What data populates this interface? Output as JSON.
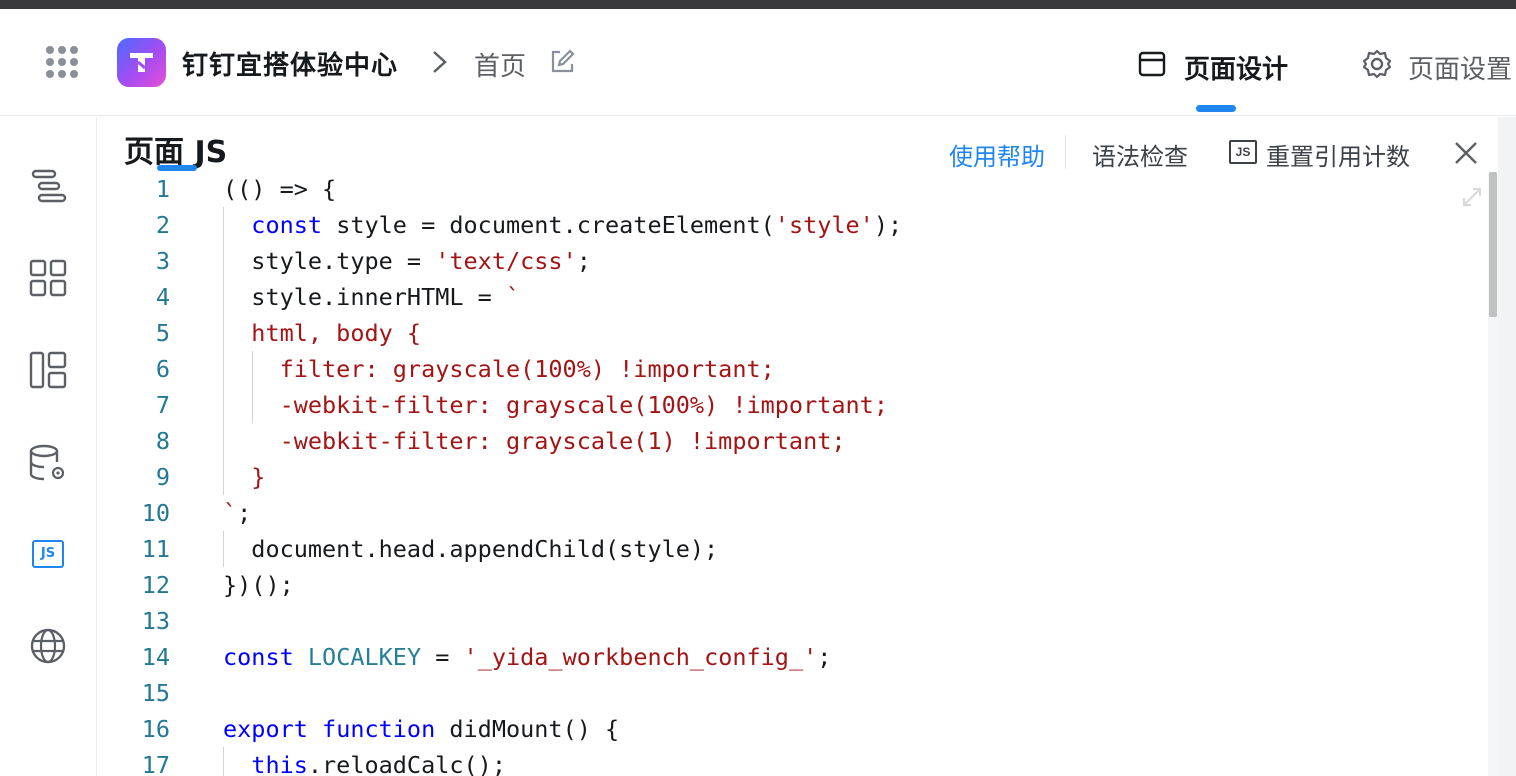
{
  "header": {
    "app_title": "钉钉宜搭体验中心",
    "breadcrumb_page": "首页",
    "tabs": [
      {
        "label": "页面设计",
        "icon": "browser-window-icon",
        "active": true
      },
      {
        "label": "页面设置",
        "icon": "gear-icon",
        "active": false
      }
    ]
  },
  "sidebar": {
    "items": [
      {
        "name": "outline-tree-icon"
      },
      {
        "name": "components-grid-icon"
      },
      {
        "name": "layout-template-icon"
      },
      {
        "name": "data-source-icon"
      },
      {
        "name": "js-icon",
        "active": true,
        "label": "JS"
      },
      {
        "name": "globe-icon"
      }
    ]
  },
  "panel": {
    "title": "页面 JS",
    "actions": {
      "help": "使用帮助",
      "lint": "语法检查",
      "js_badge": "JS",
      "reset": "重置引用计数"
    }
  },
  "code": {
    "lines": [
      {
        "n": "1",
        "t": "(() => {"
      },
      {
        "n": "2",
        "t": "  const style = document.createElement('style');"
      },
      {
        "n": "3",
        "t": "  style.type = 'text/css';"
      },
      {
        "n": "4",
        "t": "  style.innerHTML = `"
      },
      {
        "n": "5",
        "t": "  html, body {"
      },
      {
        "n": "6",
        "t": "    filter: grayscale(100%) !important;"
      },
      {
        "n": "7",
        "t": "    -webkit-filter: grayscale(100%) !important;"
      },
      {
        "n": "8",
        "t": "    -webkit-filter: grayscale(1) !important;"
      },
      {
        "n": "9",
        "t": "  }"
      },
      {
        "n": "10",
        "t": "`;"
      },
      {
        "n": "11",
        "t": "  document.head.appendChild(style);"
      },
      {
        "n": "12",
        "t": "})();"
      },
      {
        "n": "13",
        "t": ""
      },
      {
        "n": "14",
        "t": "const LOCALKEY = '_yida_workbench_config_';"
      },
      {
        "n": "15",
        "t": ""
      },
      {
        "n": "16",
        "t": "export function didMount() {"
      },
      {
        "n": "17",
        "t": "  this.reloadCalc();"
      }
    ]
  },
  "colors": {
    "accent": "#1f86f0",
    "keyword": "#0000ff",
    "string": "#a31515",
    "line_number": "#237893"
  }
}
